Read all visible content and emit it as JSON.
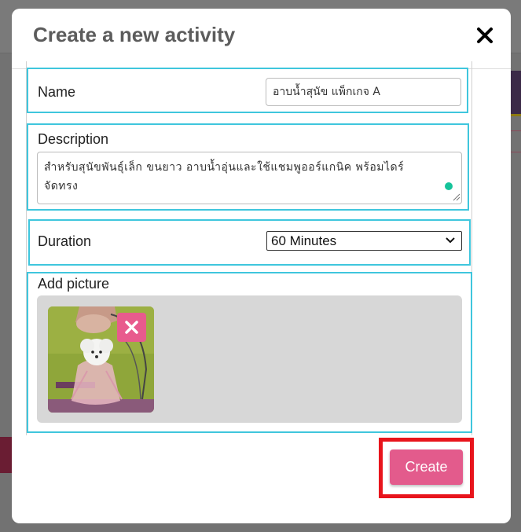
{
  "modal": {
    "title": "Create a new activity",
    "close_icon": "close-icon"
  },
  "fields": {
    "name": {
      "label": "Name",
      "value": "อาบน้ำสุนัข แพ็กเกจ A"
    },
    "description": {
      "label": "Description",
      "value_line1": "สำหรับสุนัขพันธุ์เล็ก ขนยาว อาบน้ำอุ่นและใช้แชมพูออร์แกนิค พร้อมไดร์",
      "value_line2": "จัดทรง"
    },
    "duration": {
      "label": "Duration",
      "selected": "60 Minutes"
    },
    "picture": {
      "label": "Add picture",
      "remove_icon": "close-icon"
    }
  },
  "actions": {
    "create_label": "Create"
  },
  "colors": {
    "field_border": "#3fc6dd",
    "accent": "#e35b8c",
    "highlight": "#e8141c"
  }
}
